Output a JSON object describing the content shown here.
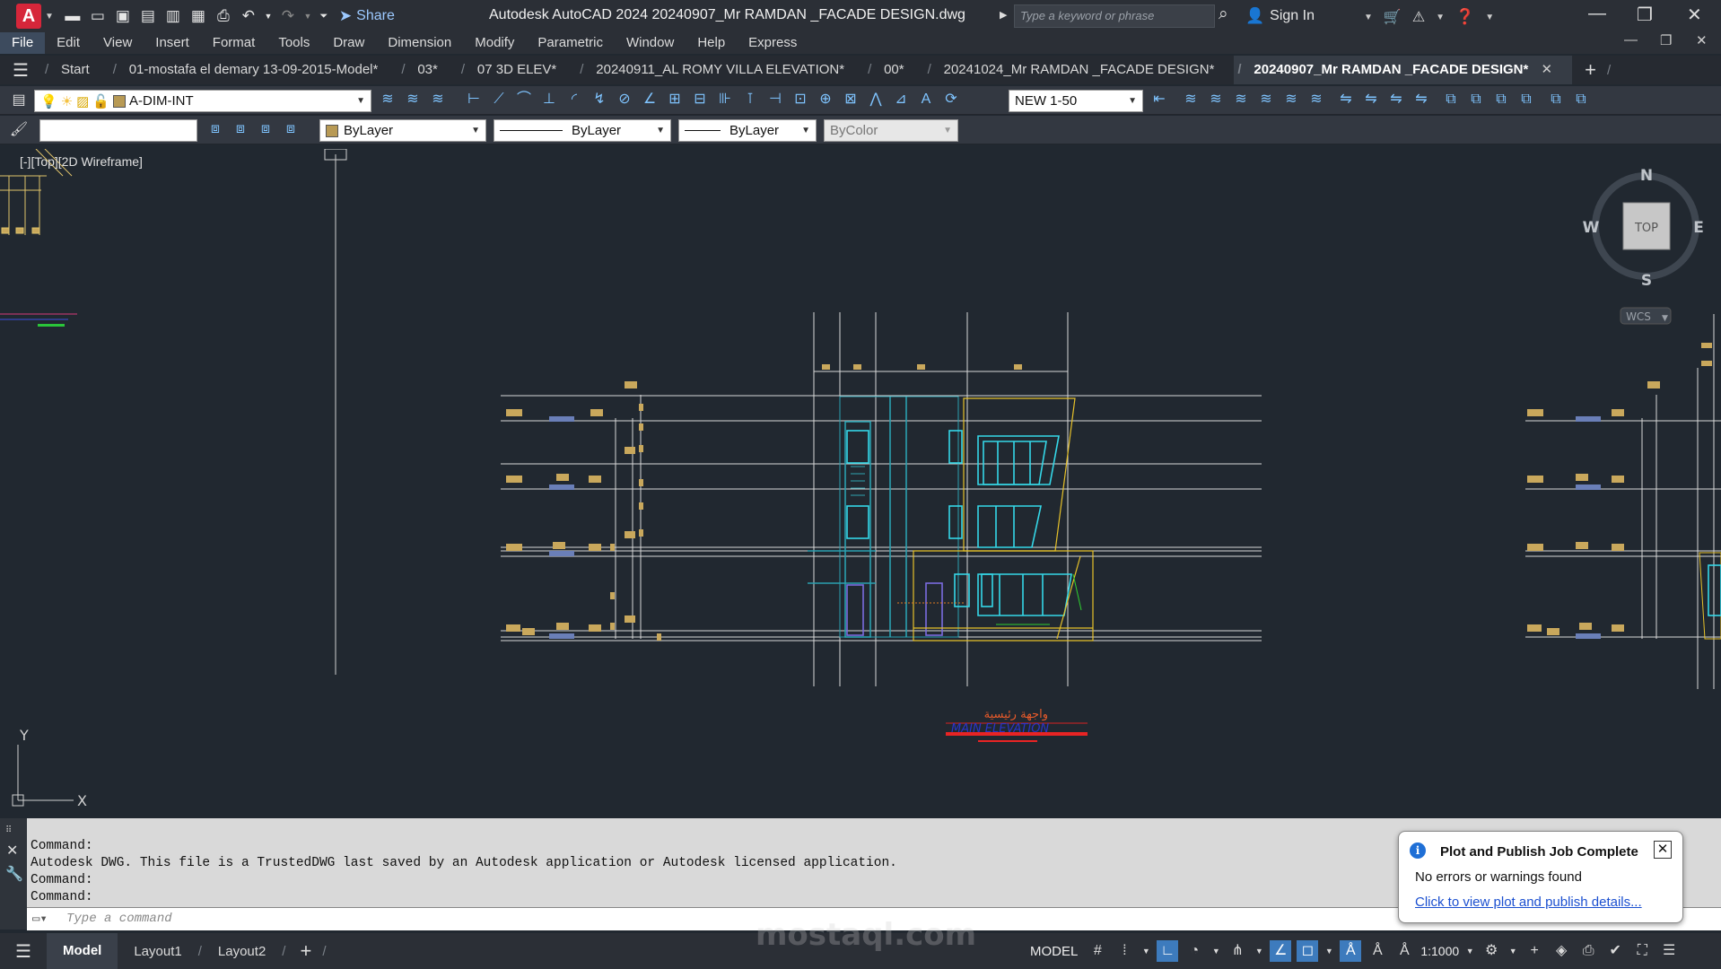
{
  "app": {
    "logo_letter": "A",
    "title": "Autodesk AutoCAD 2024    20240907_Mr RAMDAN _FACADE DESIGN.dwg",
    "share_label": "Share",
    "search_placeholder": "Type a keyword or phrase",
    "signin_label": "Sign In"
  },
  "menu": [
    "File",
    "Edit",
    "View",
    "Insert",
    "Format",
    "Tools",
    "Draw",
    "Dimension",
    "Modify",
    "Parametric",
    "Window",
    "Help",
    "Express"
  ],
  "tabs": [
    {
      "label": "Start"
    },
    {
      "label": "01-mostafa el demary 13-09-2015-Model*"
    },
    {
      "label": "03*"
    },
    {
      "label": "07 3D ELEV*"
    },
    {
      "label": "20240911_AL ROMY VILLA ELEVATION*"
    },
    {
      "label": "00*"
    },
    {
      "label": "20241024_Mr RAMDAN _FACADE DESIGN*"
    },
    {
      "label": "20240907_Mr RAMDAN _FACADE DESIGN*",
      "active": true
    }
  ],
  "toolbar1": {
    "layer_name": "A-DIM-INT",
    "scale_value": "NEW 1-50"
  },
  "toolbar2": {
    "color_value": "ByLayer",
    "linetype_value": "ByLayer",
    "lineweight_value": "ByLayer",
    "plotstyle_value": "ByColor"
  },
  "viewport": {
    "label": "[-][Top][2D Wireframe]",
    "compass": {
      "n": "N",
      "s": "S",
      "e": "E",
      "w": "W",
      "top": "TOP",
      "wcs": "WCS"
    },
    "ucs": {
      "x": "X",
      "y": "Y"
    },
    "drawing_title_ar": "واجهة رئيسية",
    "drawing_subtitle": "MAIN ELEVATION"
  },
  "command": {
    "lines": [
      "Command:",
      "Autodesk DWG.  This file is a TrustedDWG last saved by an Autodesk application or Autodesk licensed application.",
      "Command:",
      "Command:"
    ],
    "input_placeholder": "Type a command"
  },
  "statusbar": {
    "tabs": [
      "Model",
      "Layout1",
      "Layout2"
    ],
    "model_label": "MODEL",
    "scale": "1:1000"
  },
  "notification": {
    "title": "Plot and Publish Job Complete",
    "message": "No errors or warnings found",
    "link": "Click to view plot and publish details..."
  },
  "watermark": "mostaql.com",
  "colors": {
    "accent": "#3d7bbd",
    "canvas": "#212830",
    "cyan": "#35d8e8",
    "gold": "#c9a85c",
    "yellow": "#e6c12a",
    "red": "#e82424"
  }
}
